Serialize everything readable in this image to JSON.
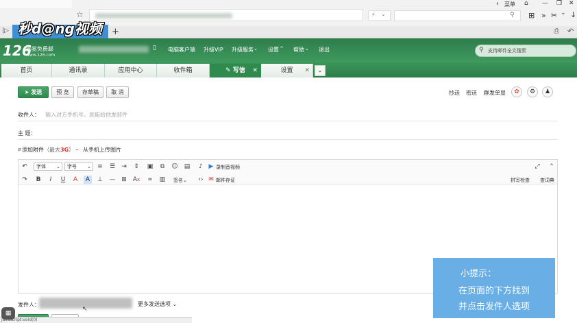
{
  "browser": {
    "menu_label": "菜单",
    "back_label": "‹",
    "win_minimize": "—",
    "win_restore": "❐",
    "win_close": "✕",
    "address_flag": "⚡",
    "logo_text": "秒d@ng视频",
    "newtab": "+",
    "ext_icons": [
      "⊞",
      "»",
      "✂",
      "⌄",
      "↓",
      "⎙",
      "↶"
    ]
  },
  "header": {
    "logo_main": "126",
    "logo_sub": "网易免费邮",
    "logo_url": "www.126.com",
    "links": [
      "电脑客户端",
      "升级VIP",
      "升级服务",
      "设置",
      "帮助",
      "退出"
    ],
    "search_placeholder": "支持邮件全文搜索"
  },
  "nav": {
    "tabs": [
      "首页",
      "通讯录",
      "应用中心",
      "收件箱",
      "写信",
      "设置"
    ]
  },
  "compose": {
    "send": "发送",
    "preview": "预 览",
    "save_draft": "存草稿",
    "cancel": "取 消",
    "cc": "抄送",
    "bcc": "密送",
    "group": "群发单显",
    "to_label": "收件人：",
    "to_placeholder": "输入对方手机号，就能给他发邮件",
    "subject_label": "主  题：",
    "attach": "添加附件",
    "attach_size_prefix": "（最大",
    "attach_size": "3G",
    "attach_size_suffix": "）",
    "mobile_upload": "从手机上传图片",
    "font_select": "字体",
    "size_select": "字号",
    "record": "录制音视频",
    "sign": "签名",
    "certify": "邮件存证",
    "spellcheck": "拼写检查",
    "dictionary": "查词典",
    "sender_label": "发件人：",
    "more_options": "更多发送选项",
    "bottom_send": "发送",
    "bottom_preview": "预 览"
  },
  "tip": {
    "title": "小提示：",
    "line1": "在页面的下方找到",
    "line2": "并点击发件人选项"
  },
  "status_text": "javascript:void(0)"
}
